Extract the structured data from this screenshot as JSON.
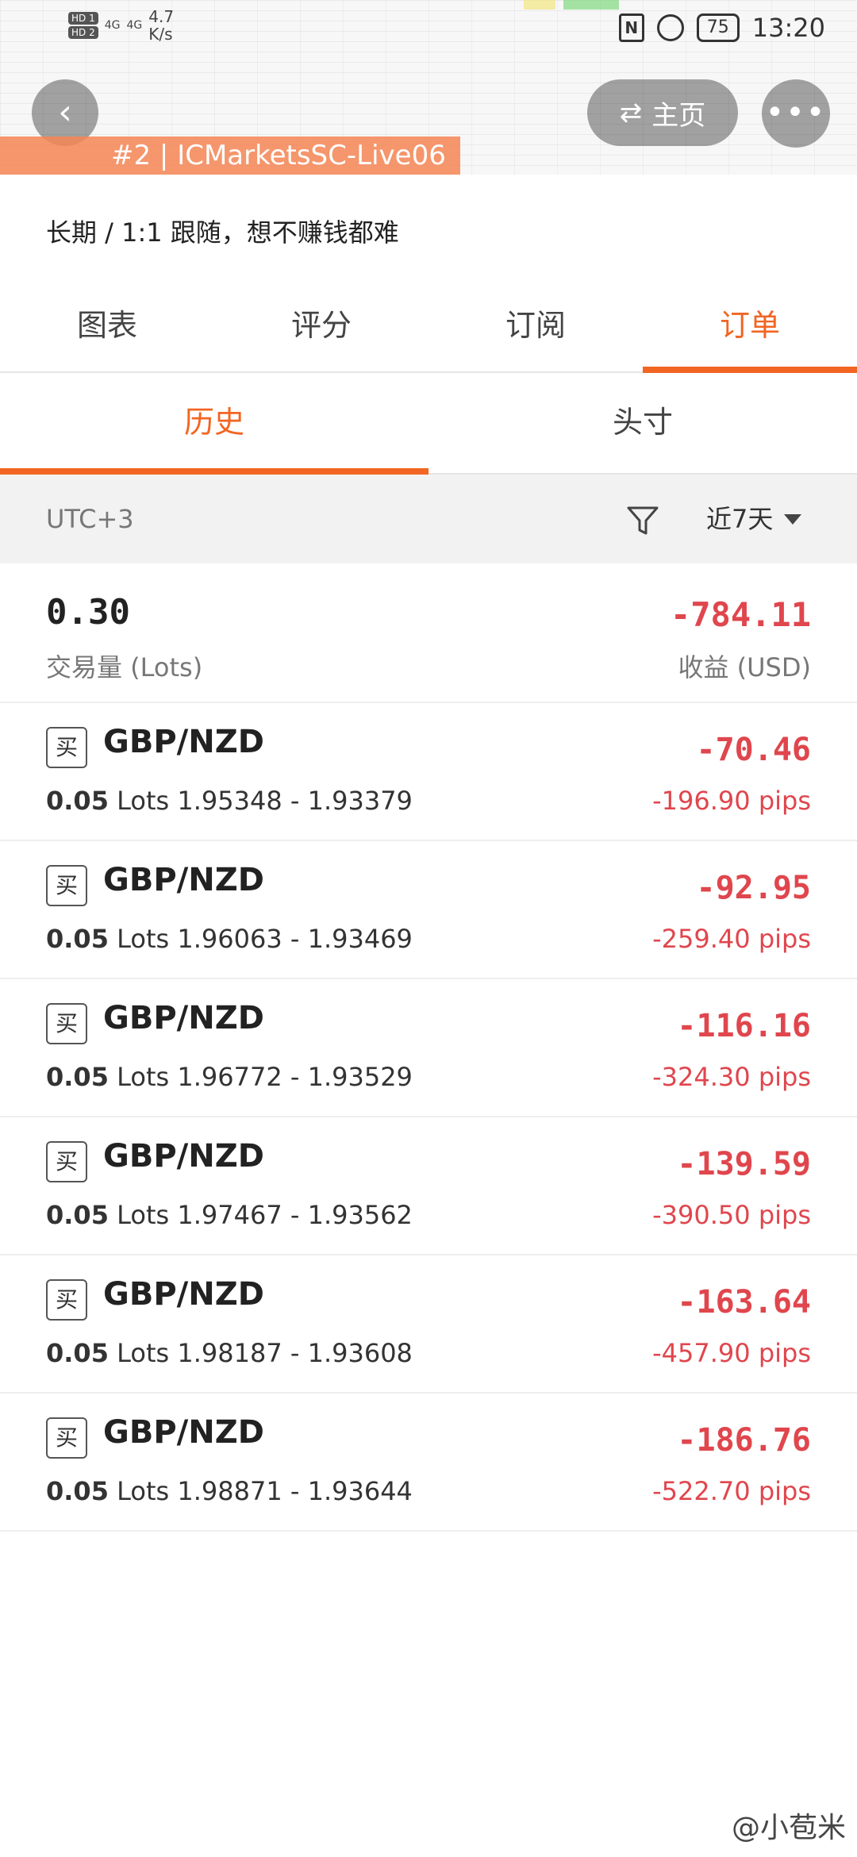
{
  "status": {
    "hd1": "HD 1",
    "hd2": "HD 2",
    "net1": "4G",
    "net2": "4G",
    "net_speed_value": "4.7",
    "net_speed_unit": "K/s",
    "battery": "75",
    "time": "13:20"
  },
  "overlay": {
    "back_icon": "back-arrow-icon",
    "home_label": "主页",
    "more_label": "•••",
    "account_label": "#2 | ICMarketsSC-Live06"
  },
  "strategy": {
    "subtitle": "长期 / 1:1 跟随，想不赚钱都难"
  },
  "tabs": [
    {
      "label": "图表"
    },
    {
      "label": "评分"
    },
    {
      "label": "订阅"
    },
    {
      "label": "订单"
    }
  ],
  "subtabs": [
    {
      "label": "历史"
    },
    {
      "label": "头寸"
    }
  ],
  "filter": {
    "timezone": "UTC+3",
    "period": "近7天"
  },
  "summary": {
    "volume": "0.30",
    "volume_label": "交易量 (Lots)",
    "profit": "-784.11",
    "profit_label": "收益 (USD)"
  },
  "trades": [
    {
      "side": "买",
      "pair": "GBP/NZD",
      "lots": "0.05",
      "lots_unit": "Lots",
      "prices": "1.95348 - 1.93379",
      "profit": "-70.46",
      "pips": "-196.90 pips"
    },
    {
      "side": "买",
      "pair": "GBP/NZD",
      "lots": "0.05",
      "lots_unit": "Lots",
      "prices": "1.96063 - 1.93469",
      "profit": "-92.95",
      "pips": "-259.40 pips"
    },
    {
      "side": "买",
      "pair": "GBP/NZD",
      "lots": "0.05",
      "lots_unit": "Lots",
      "prices": "1.96772 - 1.93529",
      "profit": "-116.16",
      "pips": "-324.30 pips"
    },
    {
      "side": "买",
      "pair": "GBP/NZD",
      "lots": "0.05",
      "lots_unit": "Lots",
      "prices": "1.97467 - 1.93562",
      "profit": "-139.59",
      "pips": "-390.50 pips"
    },
    {
      "side": "买",
      "pair": "GBP/NZD",
      "lots": "0.05",
      "lots_unit": "Lots",
      "prices": "1.98187 - 1.93608",
      "profit": "-163.64",
      "pips": "-457.90 pips"
    },
    {
      "side": "买",
      "pair": "GBP/NZD",
      "lots": "0.05",
      "lots_unit": "Lots",
      "prices": "1.98871 - 1.93644",
      "profit": "-186.76",
      "pips": "-522.70 pips"
    }
  ],
  "watermark": "@小苞米",
  "colors": {
    "accent": "#f26522",
    "loss": "#e0464d"
  }
}
